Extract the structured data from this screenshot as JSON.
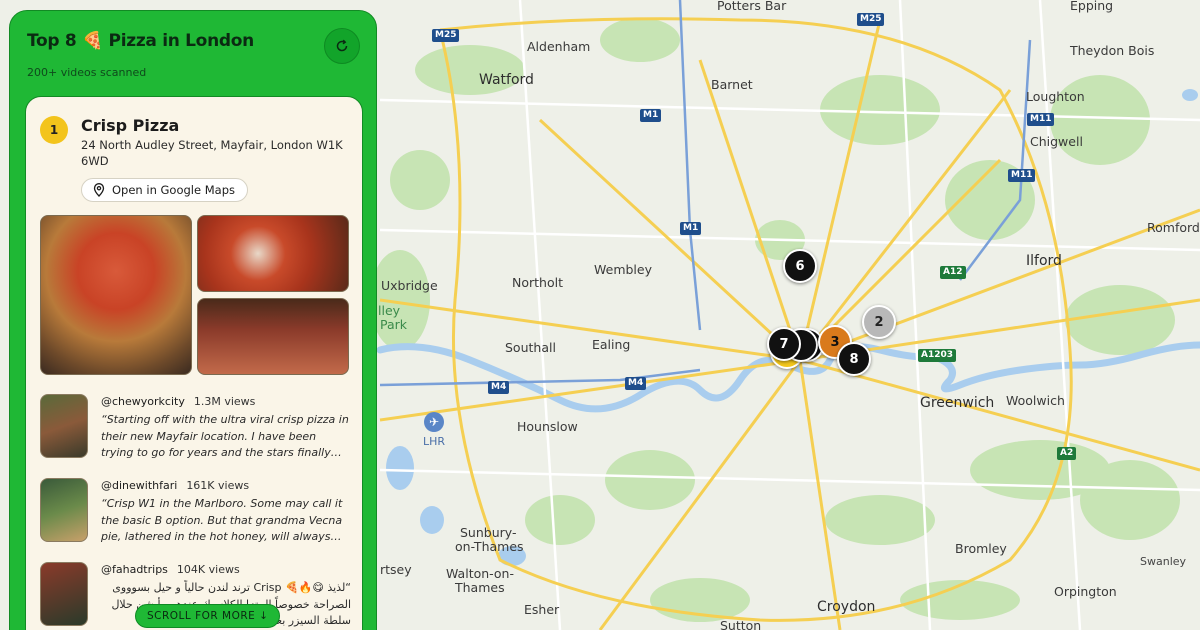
{
  "panel": {
    "title": "Top 8 🍕 Pizza in London",
    "subtitle": "200+ videos scanned",
    "refresh_icon": "refresh-icon"
  },
  "featured": {
    "rank": "1",
    "name": "Crisp Pizza",
    "address": "24 North Audley Street, Mayfair, London W1K 6WD",
    "maps_button": "Open in Google Maps",
    "maps_icon": "location-pin-icon"
  },
  "reviews": [
    {
      "handle": "@chewyorkcity",
      "views": "1.3M views",
      "quote": "“Starting off with the ultra viral crisp pizza in their new Mayfair location. I have been trying to go for years and the stars finally aligned…",
      "rtl": false
    },
    {
      "handle": "@dinewithfari",
      "views": "161K views",
      "quote": "“Crisp W1 in the Marlboro. Some may call it the basic B option. But that grandma Vecna pie, lathered in the hot honey, will always…",
      "rtl": false
    },
    {
      "handle": "@fahadtrips",
      "views": "104K views",
      "quote": "“لذيذ 😋🔥🍕 Crisp ترند لندن حالياً و حيل بسوووى الصراحة خصوصاً البيتزا الكلاسيك عندهم وأيشن حلال سلطة السيزر بعد لذيذه جربوه وبالعافية❤️…",
      "rtl": true
    }
  ],
  "scroll_button": "SCROLL FOR MORE ↓",
  "map": {
    "places": [
      {
        "label": "Potters Bar",
        "cls": "med"
      },
      {
        "label": "Epping",
        "cls": "med"
      },
      {
        "label": "Aldenham",
        "cls": "med"
      },
      {
        "label": "Theydon Bois",
        "cls": "med"
      },
      {
        "label": "Watford",
        "cls": "big"
      },
      {
        "label": "Barnet",
        "cls": "med"
      },
      {
        "label": "Loughton",
        "cls": "med"
      },
      {
        "label": "Chigwell",
        "cls": "med"
      },
      {
        "label": "Romford",
        "cls": "med"
      },
      {
        "label": "Ilford",
        "cls": "big"
      },
      {
        "label": "Uxbridge",
        "cls": "med"
      },
      {
        "label": "Northolt",
        "cls": "med"
      },
      {
        "label": "Wembley",
        "cls": "med"
      },
      {
        "label": "Southall",
        "cls": "med"
      },
      {
        "label": "Ealing",
        "cls": "med"
      },
      {
        "label": "Greenwich",
        "cls": "big"
      },
      {
        "label": "Woolwich",
        "cls": "med"
      },
      {
        "label": "Hounslow",
        "cls": "med"
      },
      {
        "label": "Sunbury-",
        "cls": "med"
      },
      {
        "label": "on-Thames",
        "cls": "med"
      },
      {
        "label": "Walton-on-",
        "cls": "med"
      },
      {
        "label": "Thames",
        "cls": "med"
      },
      {
        "label": "Esher",
        "cls": "med"
      },
      {
        "label": "Croydon",
        "cls": "big"
      },
      {
        "label": "Bromley",
        "cls": "med"
      },
      {
        "label": "Orpington",
        "cls": "med"
      },
      {
        "label": "Swanley",
        "cls": "sm"
      },
      {
        "label": "Sutton",
        "cls": "med"
      },
      {
        "label": "rtsey",
        "cls": "med"
      },
      {
        "label": "lley",
        "cls": "green"
      },
      {
        "label": "Park",
        "cls": "green"
      }
    ],
    "roads": [
      "M25",
      "M25",
      "M1",
      "M11",
      "M1",
      "M11",
      "A12",
      "M4",
      "M4",
      "A1203",
      "A2"
    ],
    "airport": {
      "label": "LHR",
      "icon": "airplane-icon"
    },
    "pins": [
      "6",
      "2",
      "7",
      "",
      "3",
      "8"
    ]
  }
}
